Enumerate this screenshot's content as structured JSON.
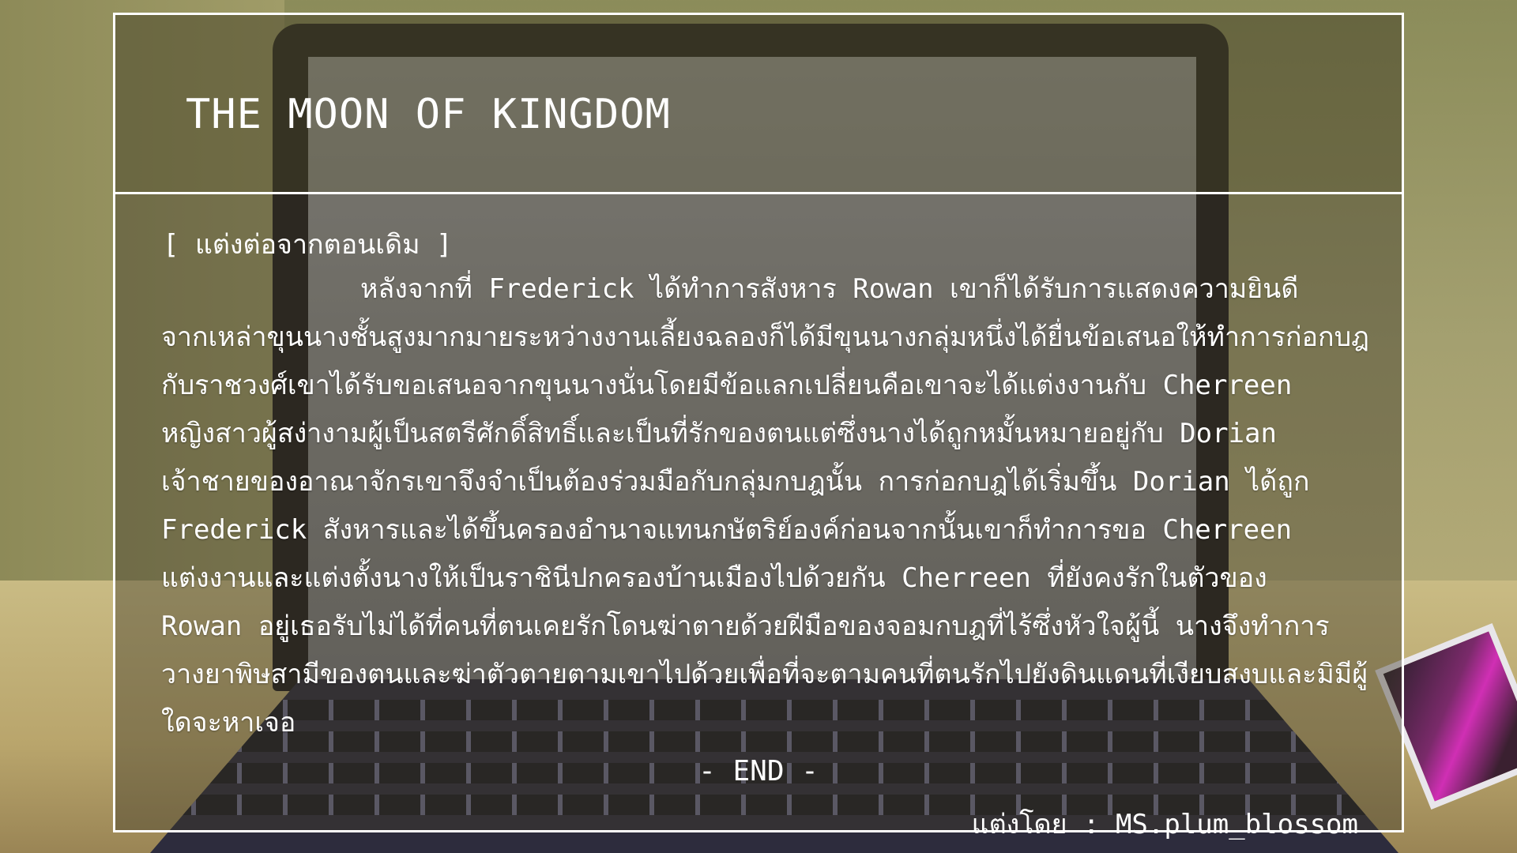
{
  "title": "THE MOON OF KINGDOM",
  "subtitle": "[ แต่งต่อจากตอนเดิม ]",
  "story_lines": [
    "หลังจากที่ Frederick ได้ทำการสังหาร Rowan เขาก็ได้รับการแสดงความยินดี",
    "จากเหล่าขุนนางชั้นสูงมากมายระหว่างงานเลี้ยงฉลองก็ได้มีขุนนางกลุ่มหนึ่งได้ยื่นข้อเสนอให้ทำการก่อกบฎ",
    "กับราชวงศ์เขาได้รับขอเสนอจากขุนนางนั่นโดยมีข้อแลกเปลี่ยนคือเขาจะได้แต่งงานกับ Cherreen",
    "หญิงสาวผู้สง่างามผู้เป็นสตรีศักดิ์สิทธิ์และเป็นที่รักของตนแต่ซึ่งนางได้ถูกหมั้นหมายอยู่กับ Dorian",
    "เจ้าชายของอาณาจักรเขาจึงจำเป็นต้องร่วมมือกับกลุ่มกบฎนั้น การก่อกบฎได้เริ่มขึ้น Dorian ได้ถูก",
    "Frederick สังหารและได้ขึ้นครองอำนาจแทนกษัตริย์องค์ก่อนจากนั้นเขาก็ทำการขอ Cherreen",
    "แต่งงานและแต่งตั้งนางให้เป็นราชินีปกครองบ้านเมืองไปด้วยกัน Cherreen ที่ยังคงรักในตัวของ",
    "Rowan อยู่เธอรับไม่ได้ที่คนที่ตนเคยรักโดนฆ่าตายด้วยฝีมือของจอมกบฎที่ไร้ซึ่งหัวใจผู้นี้ นางจึงทำการ",
    "วางยาพิษสามีของตนและฆ่าตัวตายตามเขาไปด้วยเพื่อที่จะตามคนที่ตนรักไปยังดินแดนที่เงียบสงบและมิมีผู้",
    "ใดจะหาเจอ"
  ],
  "end_label": "- END -",
  "author_label": "แต่งโดย : MS.plum_blossom"
}
